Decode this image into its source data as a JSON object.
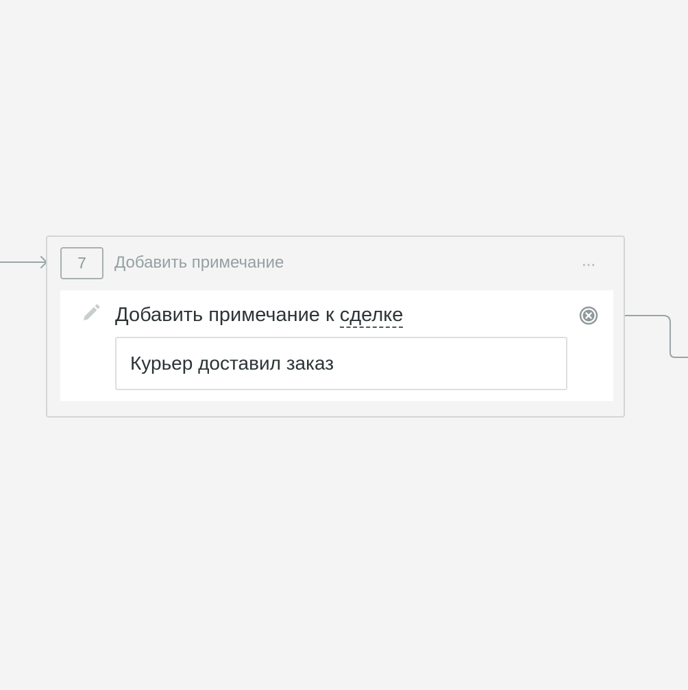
{
  "step": {
    "number": "7",
    "title": "Добавить примечание",
    "more_label": "···"
  },
  "action": {
    "label_prefix": "Добавить примечание к",
    "entity_link": "сделке",
    "note_value": "Курьер доставил заказ"
  },
  "icons": {
    "edit": "pencil-icon",
    "remove": "remove-circle-x-icon"
  },
  "colors": {
    "background": "#f4f4f4",
    "card_border": "#d2d5d6",
    "muted_text": "#95a0a3",
    "main_text": "#2d3436",
    "connector": "#9aa4a6"
  }
}
